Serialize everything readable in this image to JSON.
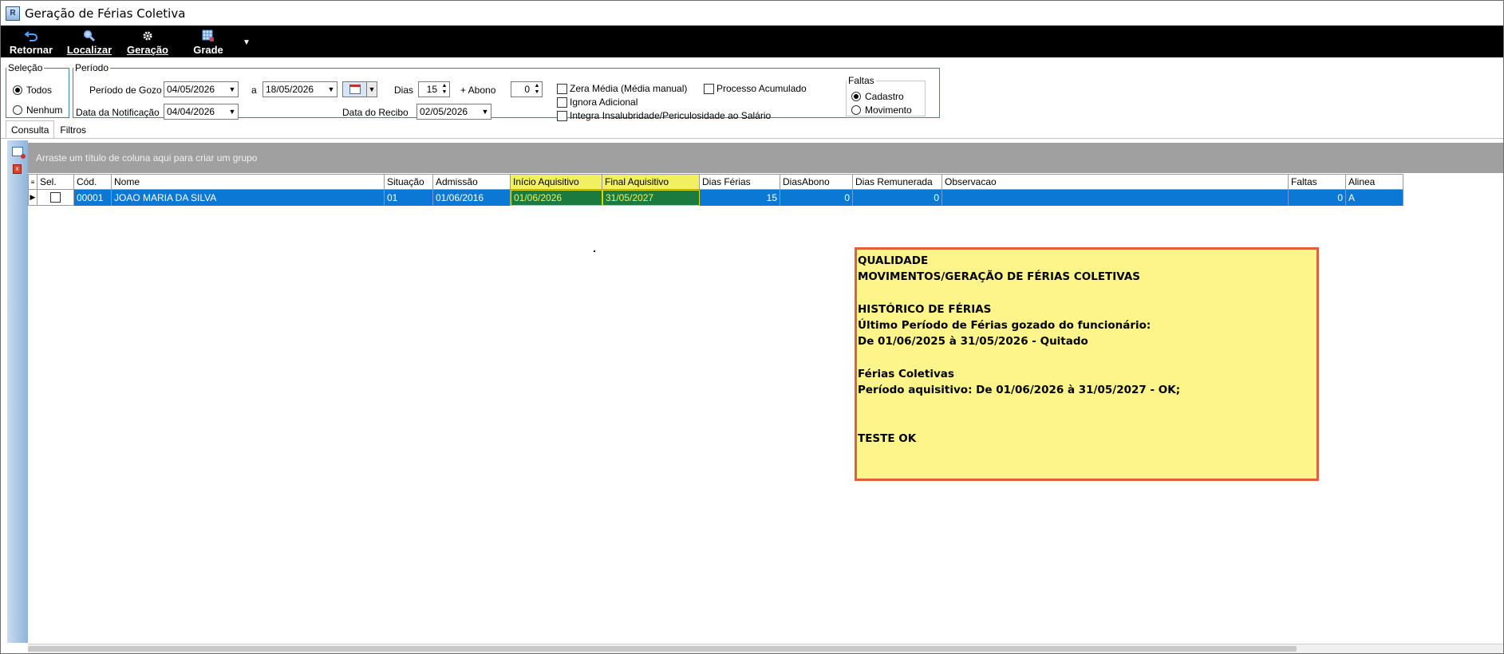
{
  "window": {
    "title": "Geração de Férias Coletiva"
  },
  "toolbar": {
    "retornar": "Retornar",
    "localizar": "Localizar",
    "geracao": "Geração",
    "grade": "Grade"
  },
  "selecao": {
    "legend": "Seleção",
    "todos": "Todos",
    "nenhum": "Nenhum",
    "selected": "Todos"
  },
  "periodo": {
    "legend": "Período",
    "gozo_label": "Período de Gozo",
    "gozo_inicio": "04/05/2026",
    "a_label": "a",
    "gozo_fim": "18/05/2026",
    "dias_label": "Dias",
    "dias_value": "15",
    "abono_label": "+ Abono",
    "abono_value": "0",
    "notificacao_label": "Data da Notificação",
    "notificacao_value": "04/04/2026",
    "recibo_label": "Data do Recibo",
    "recibo_value": "02/05/2026",
    "zera_media": "Zera Média (Média manual)",
    "ignora_adicional": "Ignora Adicional",
    "integra_insalubridade": "Integra Insalubridade/Periculosidade ao Salário",
    "processo_acumulado": "Processo Acumulado"
  },
  "faltas": {
    "legend": "Faltas",
    "cadastro": "Cadastro",
    "movimento": "Movimento",
    "selected": "Cadastro"
  },
  "tabs": [
    {
      "label": "Consulta",
      "active": true
    },
    {
      "label": "Filtros",
      "active": false
    }
  ],
  "grid": {
    "group_hint": "Arraste um título de coluna aqui para criar um grupo",
    "columns": [
      "Sel.",
      "Cód.",
      "Nome",
      "Situação",
      "Admissão",
      "Início Aquisitivo",
      "Final Aquisitivo",
      "Dias Férias",
      "DiasAbono",
      "Dias Remunerada",
      "Observacao",
      "Faltas",
      "Alinea"
    ],
    "rows": [
      {
        "sel": true,
        "cod": "00001",
        "nome": "JOAO MARIA DA SILVA",
        "situacao": "01",
        "admissao": "01/06/2016",
        "inicio_aquisitivo": "01/06/2026",
        "final_aquisitivo": "31/05/2027",
        "dias_ferias": "15",
        "dias_abono": "0",
        "dias_remunerada": "0",
        "observacao": "",
        "faltas": "0",
        "alinea": "A"
      }
    ]
  },
  "note": {
    "lines": [
      "QUALIDADE",
      "MOVIMENTOS/GERAÇÃO DE FÉRIAS COLETIVAS",
      "",
      "HISTÓRICO DE FÉRIAS",
      "Último Período de Férias gozado do funcionário:",
      "De 01/06/2025 à 31/05/2026 - Quitado",
      "",
      "Férias Coletivas",
      "Período aquisitivo: De 01/06/2026 à 31/05/2027 - OK;",
      "",
      "",
      "TESTE OK"
    ]
  },
  "colors": {
    "toolbar_bg": "#000000",
    "row_selected": "#0a78d4",
    "highlight_header": "#f0f060",
    "highlight_cell": "#1b7a3e",
    "note_bg": "#fdf58a",
    "note_border": "#e0603a"
  }
}
